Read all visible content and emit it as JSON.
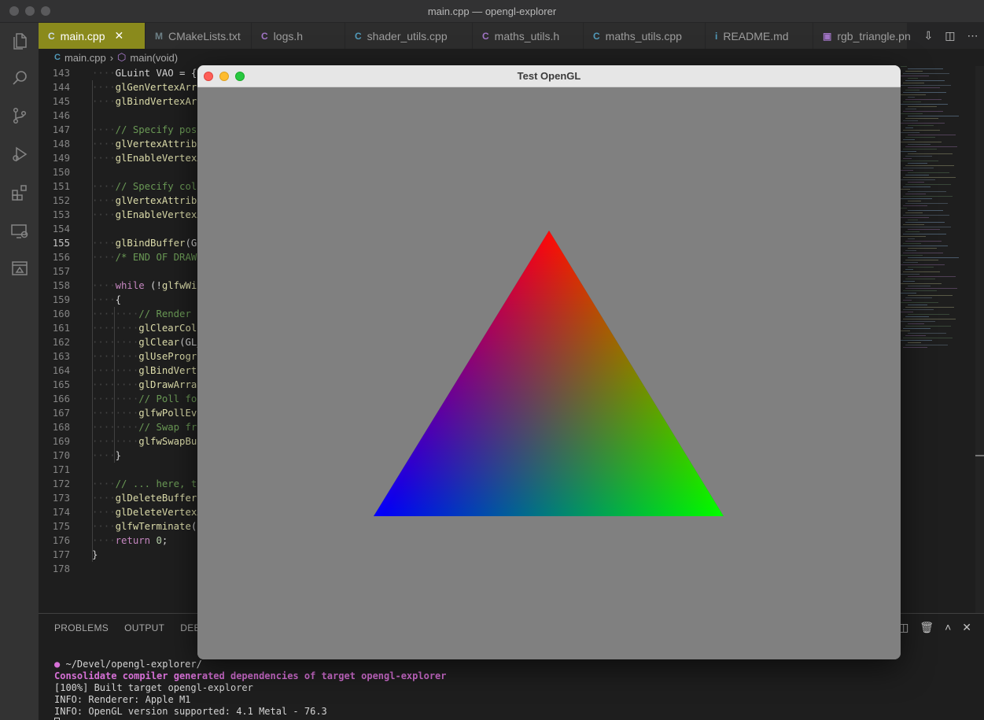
{
  "window": {
    "title": "main.cpp — opengl-explorer"
  },
  "activity_bar": [
    "explorer-icon",
    "search-icon",
    "source-control-icon",
    "run-debug-icon",
    "extensions-icon",
    "remote-explorer-icon",
    "database-icon"
  ],
  "tabs": [
    {
      "label": "main.cpp",
      "icon": "C",
      "icon_color": "#519aba",
      "active": true
    },
    {
      "label": "CMakeLists.txt",
      "icon": "M",
      "icon_color": "#6d8086"
    },
    {
      "label": "logs.h",
      "icon": "C",
      "icon_color": "#a074c4"
    },
    {
      "label": "shader_utils.cpp",
      "icon": "C",
      "icon_color": "#519aba"
    },
    {
      "label": "maths_utils.h",
      "icon": "C",
      "icon_color": "#a074c4"
    },
    {
      "label": "maths_utils.cpp",
      "icon": "C",
      "icon_color": "#519aba"
    },
    {
      "label": "README.md",
      "icon": "i",
      "icon_color": "#519aba"
    },
    {
      "label": "rgb_triangle.pn",
      "icon": "▣",
      "icon_color": "#a074c4"
    }
  ],
  "breadcrumb": {
    "file": "main.cpp",
    "symbol": "main(void)"
  },
  "editor": {
    "current_line": 155,
    "lines": [
      {
        "n": 143,
        "i": 1,
        "t": [
          [
            "",
            "GLuint VAO = {};"
          ]
        ]
      },
      {
        "n": 144,
        "i": 1,
        "t": [
          [
            "fn",
            "glGenVertexArra"
          ]
        ]
      },
      {
        "n": 145,
        "i": 1,
        "t": [
          [
            "fn",
            "glBindVertexArr"
          ]
        ]
      },
      {
        "n": 146,
        "i": 0,
        "t": []
      },
      {
        "n": 147,
        "i": 1,
        "t": [
          [
            "cm",
            "// Specify posi"
          ]
        ]
      },
      {
        "n": 148,
        "i": 1,
        "t": [
          [
            "fn",
            "glVertexAttribP"
          ]
        ]
      },
      {
        "n": 149,
        "i": 1,
        "t": [
          [
            "fn",
            "glEnableVertexA"
          ]
        ]
      },
      {
        "n": 150,
        "i": 0,
        "t": []
      },
      {
        "n": 151,
        "i": 1,
        "t": [
          [
            "cm",
            "// Specify colo"
          ]
        ]
      },
      {
        "n": 152,
        "i": 1,
        "t": [
          [
            "fn",
            "glVertexAttribP"
          ]
        ]
      },
      {
        "n": 153,
        "i": 1,
        "t": [
          [
            "fn",
            "glEnableVertexA"
          ]
        ]
      },
      {
        "n": 154,
        "i": 0,
        "t": []
      },
      {
        "n": 155,
        "i": 1,
        "t": [
          [
            "fn",
            "glBindBuffer"
          ],
          [
            "",
            "(GL"
          ]
        ]
      },
      {
        "n": 156,
        "i": 1,
        "t": [
          [
            "cm",
            "/* END OF DRAWI"
          ]
        ]
      },
      {
        "n": 157,
        "i": 0,
        "t": []
      },
      {
        "n": 158,
        "i": 1,
        "t": [
          [
            "kw",
            "while"
          ],
          [
            "",
            " (!"
          ],
          [
            "fn",
            "glfwWin"
          ]
        ]
      },
      {
        "n": 159,
        "i": 1,
        "t": [
          [
            "",
            "{"
          ]
        ]
      },
      {
        "n": 160,
        "i": 2,
        "t": [
          [
            "cm",
            "// Render"
          ]
        ]
      },
      {
        "n": 161,
        "i": 2,
        "t": [
          [
            "fn",
            "glClearColo"
          ]
        ]
      },
      {
        "n": 162,
        "i": 2,
        "t": [
          [
            "fn",
            "glClear"
          ],
          [
            "",
            "(GL_"
          ]
        ]
      },
      {
        "n": 163,
        "i": 2,
        "t": [
          [
            "fn",
            "glUseProgra"
          ]
        ]
      },
      {
        "n": 164,
        "i": 2,
        "t": [
          [
            "fn",
            "glBindVerte"
          ]
        ]
      },
      {
        "n": 165,
        "i": 2,
        "t": [
          [
            "fn",
            "glDrawArray"
          ]
        ]
      },
      {
        "n": 166,
        "i": 2,
        "t": [
          [
            "cm",
            "// Poll for"
          ]
        ]
      },
      {
        "n": 167,
        "i": 2,
        "t": [
          [
            "fn",
            "glfwPollEve"
          ]
        ]
      },
      {
        "n": 168,
        "i": 2,
        "t": [
          [
            "cm",
            "// Swap fro"
          ]
        ]
      },
      {
        "n": 169,
        "i": 2,
        "t": [
          [
            "fn",
            "glfwSwapBuf"
          ]
        ]
      },
      {
        "n": 170,
        "i": 1,
        "t": [
          [
            "",
            "}"
          ]
        ]
      },
      {
        "n": 171,
        "i": 0,
        "t": []
      },
      {
        "n": 172,
        "i": 1,
        "t": [
          [
            "cm",
            "// ... here, th"
          ]
        ]
      },
      {
        "n": 173,
        "i": 1,
        "t": [
          [
            "fn",
            "glDeleteBuffers"
          ]
        ]
      },
      {
        "n": 174,
        "i": 1,
        "t": [
          [
            "fn",
            "glDeleteVertexA"
          ]
        ]
      },
      {
        "n": 175,
        "i": 1,
        "t": [
          [
            "fn",
            "glfwTerminate"
          ],
          [
            "",
            "()"
          ]
        ]
      },
      {
        "n": 176,
        "i": 1,
        "t": [
          [
            "kw",
            "return"
          ],
          [
            "",
            " "
          ],
          [
            "num",
            "0"
          ],
          [
            "",
            ";"
          ]
        ]
      },
      {
        "n": 177,
        "i": 0,
        "t": [
          [
            "",
            "}"
          ]
        ]
      },
      {
        "n": 178,
        "i": 0,
        "t": []
      }
    ]
  },
  "panel": {
    "tabs": [
      "PROBLEMS",
      "OUTPUT",
      "DEBU"
    ],
    "terminal": {
      "prompt_path": "~/Devel/opengl-explorer/",
      "lines": [
        {
          "style": "magenta",
          "text": "Consolidate compiler generated dependencies of target opengl-explorer"
        },
        {
          "style": "plain",
          "text": "[100%] Built target opengl-explorer"
        },
        {
          "style": "plain",
          "text": "INFO: Renderer: Apple M1"
        },
        {
          "style": "plain",
          "text": "INFO: OpenGL version supported: 4.1 Metal - 76.3"
        }
      ]
    }
  },
  "gl_window": {
    "title": "Test OpenGL",
    "clear_color": "#808080",
    "triangle": {
      "top_color": "#ff0000",
      "left_color": "#0000ff",
      "right_color": "#00ff00"
    }
  }
}
